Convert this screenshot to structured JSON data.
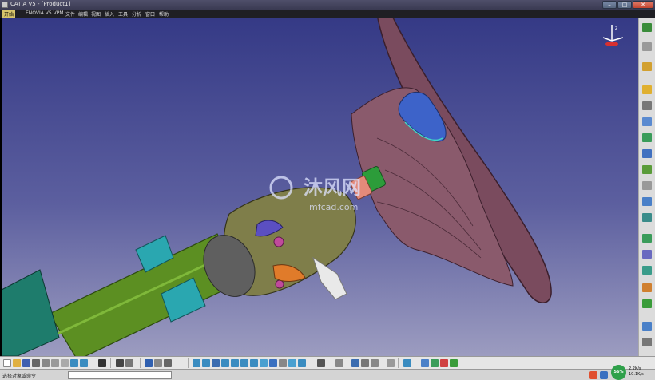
{
  "window": {
    "title": "CATIA V5 - [Product1]",
    "minimize": "–",
    "maximize": "□",
    "close": "✕"
  },
  "menubar": {
    "items": [
      "开始",
      "ENOVIA V5 VPM",
      "文件",
      "编辑",
      "视图",
      "插入",
      "工具",
      "分析",
      "窗口",
      "帮助"
    ]
  },
  "viewport": {
    "watermark_brand": "沐风网",
    "watermark_url": "mfcad.com",
    "background_top": "#353a86",
    "background_bottom": "#9c9cc0"
  },
  "compass": {
    "label": "z"
  },
  "statusbar": {
    "prompt": "选择对象或命令",
    "net_percent": "56%",
    "upload_rate": "2.2K/s",
    "download_rate": "10.1K/s"
  },
  "colors": {
    "steering_wheel": "#7a4b5e",
    "column_tube": "#5c8f22",
    "bracket": "#2aa7b0",
    "housing": "#7f7e4a",
    "airbag_cover": "#3d63c9"
  }
}
